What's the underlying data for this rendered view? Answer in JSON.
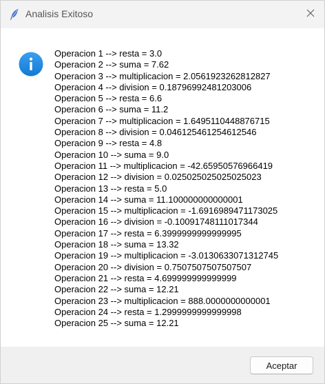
{
  "window": {
    "title": "Analisis Exitoso",
    "app_icon": "feather-icon",
    "close_icon": "close-icon"
  },
  "dialog": {
    "icon": "info-icon",
    "icon_color": "#1f8ae0",
    "lines": [
      "Operacion 1 --> resta = 3.0",
      "Operacion 2 --> suma = 7.62",
      "Operacion 3 --> multiplicacion = 2.0561923262812827",
      "Operacion 4 --> division = 0.18796992481203006",
      "Operacion 5 --> resta = 6.6",
      "Operacion 6 --> suma = 11.2",
      "Operacion 7 --> multiplicacion = 1.6495110448876715",
      "Operacion 8 --> division = 0.046125461254612546",
      "Operacion 9 --> resta = 4.8",
      "Operacion 10 --> suma = 9.0",
      "Operacion 11 --> multiplicacion = -42.65950576966419",
      "Operacion 12 --> division = 0.025025025025025023",
      "Operacion 13 --> resta = 5.0",
      "Operacion 14 --> suma = 11.100000000000001",
      "Operacion 15 --> multiplicacion = -1.6916989471173025",
      "Operacion 16 --> division = -0.10091748111017344",
      "Operacion 17 --> resta = 6.3999999999999995",
      "Operacion 18 --> suma = 13.32",
      "Operacion 19 --> multiplicacion = -3.0130633071312745",
      "Operacion 20 --> division = 0.7507507507507507",
      "Operacion 21 --> resta = 4.699999999999999",
      "Operacion 22 --> suma = 12.21",
      "Operacion 23 --> multiplicacion = 888.0000000000001",
      "Operacion 24 --> resta = 1.2999999999999998",
      "Operacion 25 --> suma = 12.21"
    ]
  },
  "footer": {
    "ok_label": "Aceptar"
  }
}
